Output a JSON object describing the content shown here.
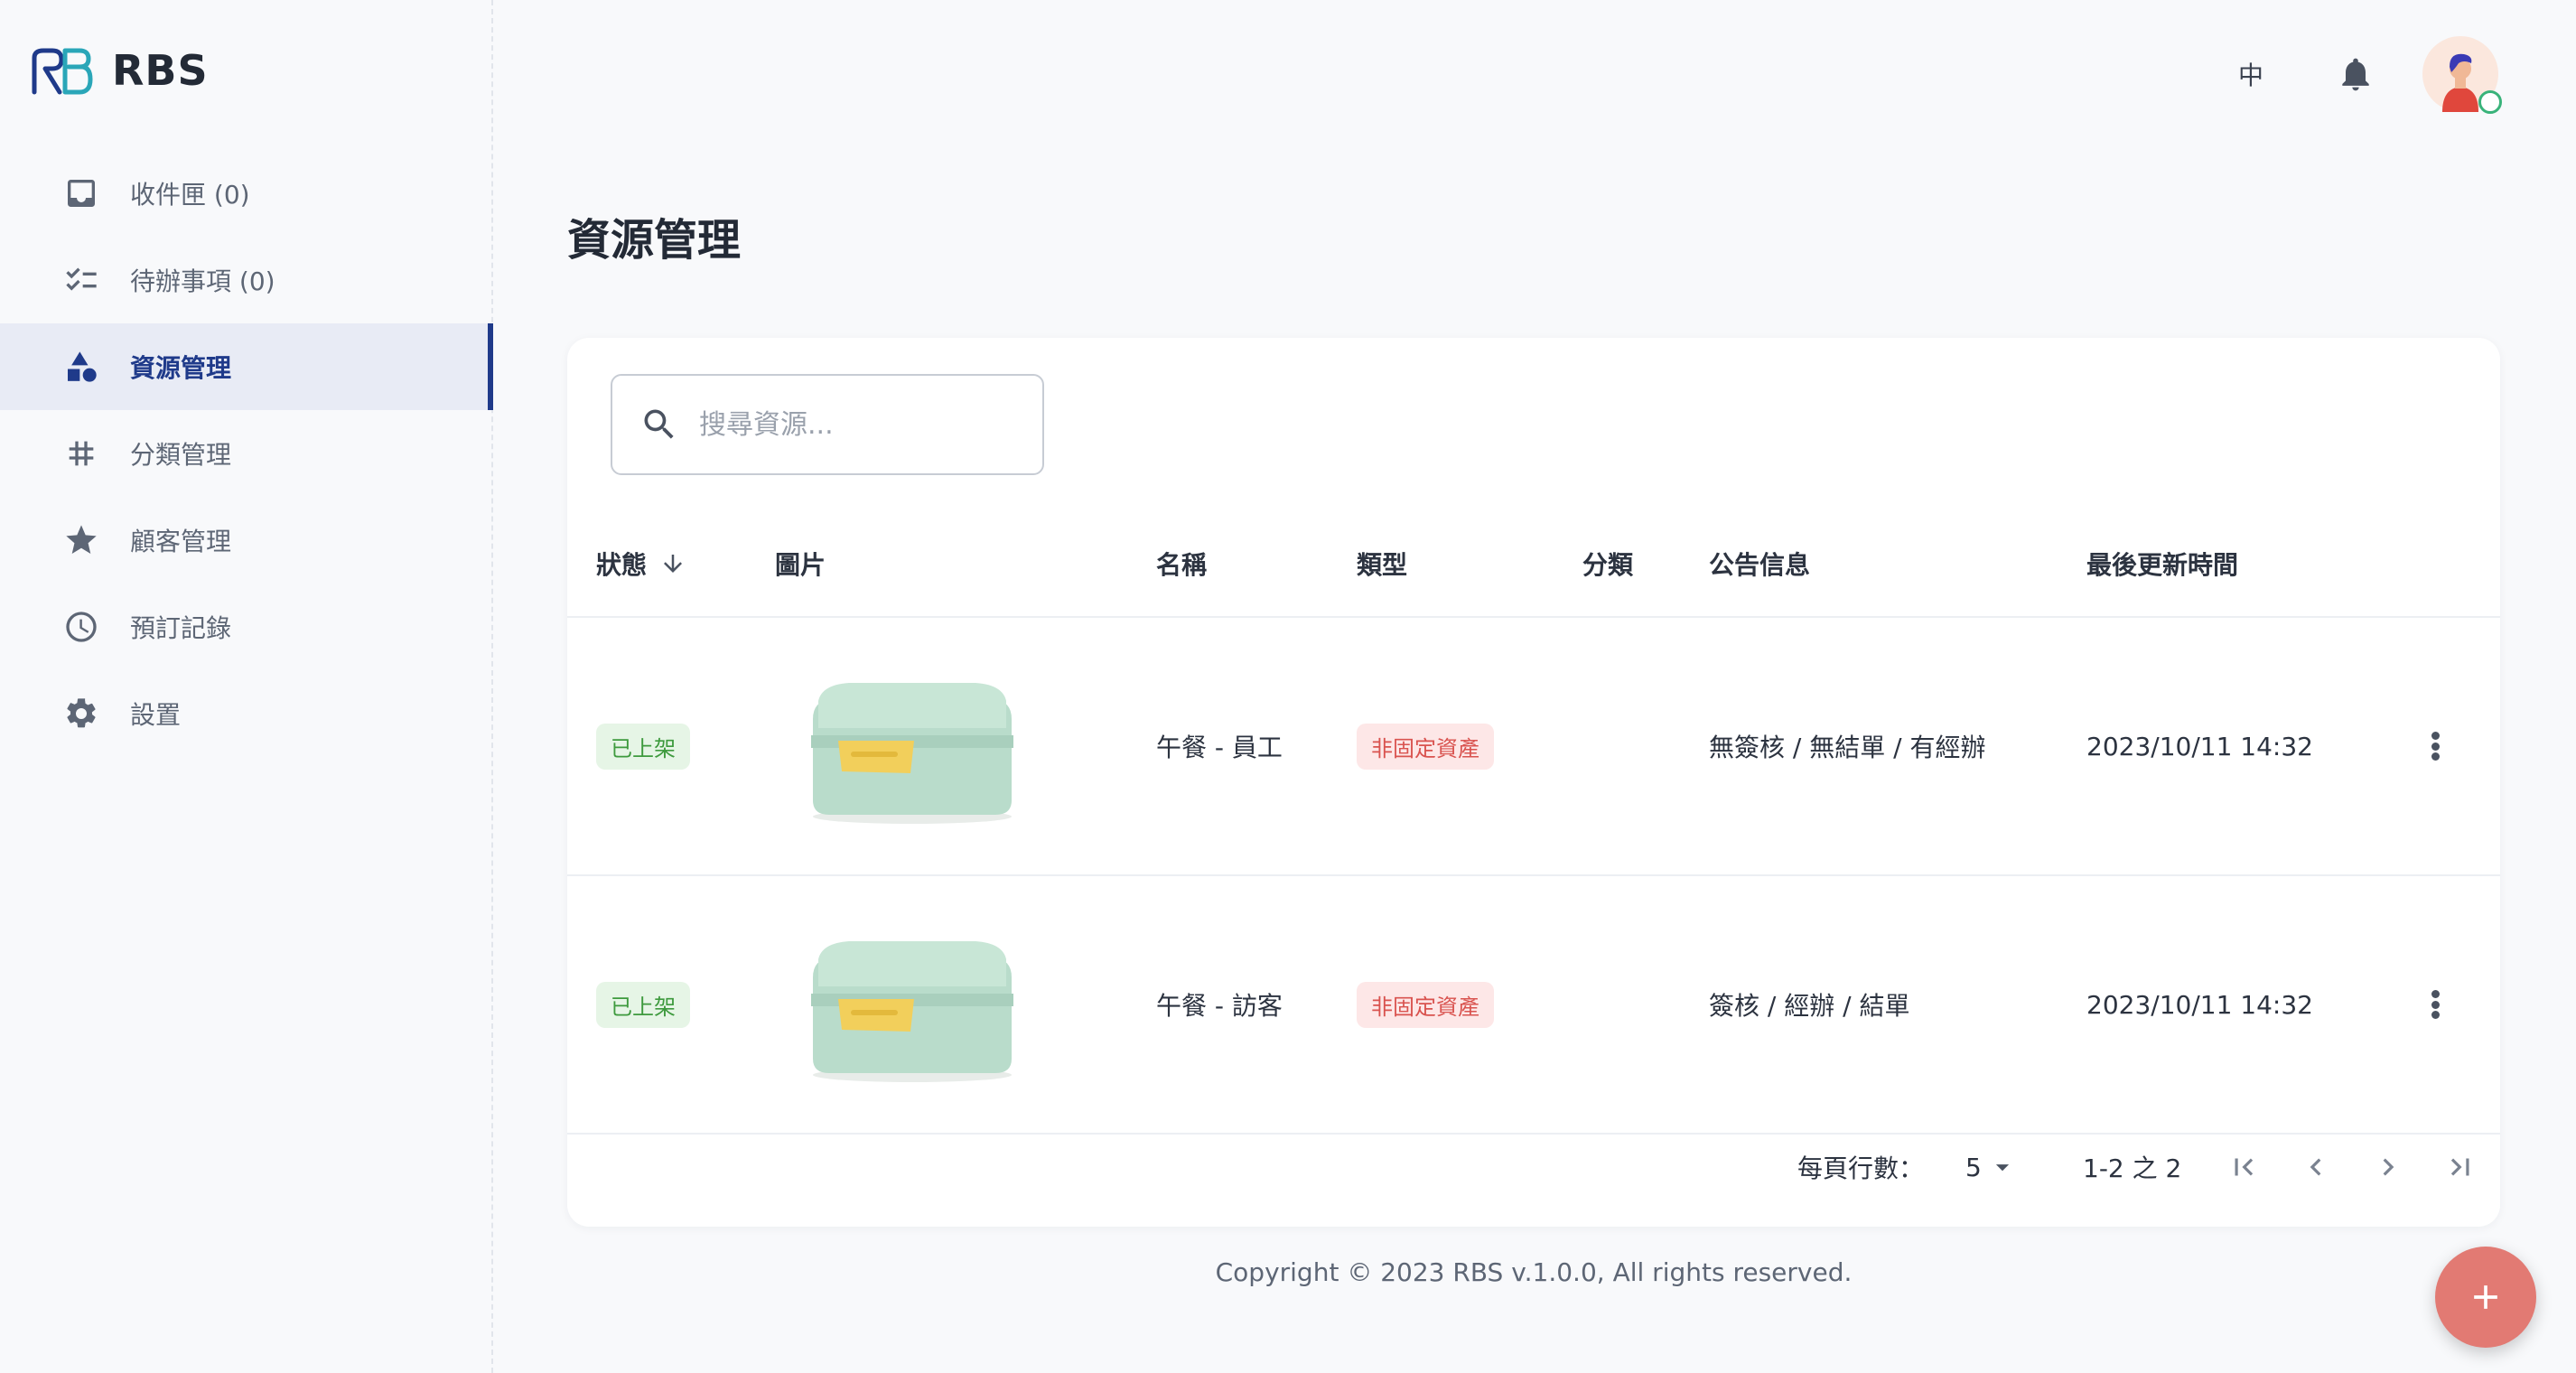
{
  "app": {
    "name": "RBS"
  },
  "sidebar": {
    "items": [
      {
        "label": "收件匣 (0)",
        "icon": "inbox-icon",
        "active": false
      },
      {
        "label": "待辦事項 (0)",
        "icon": "checklist-icon",
        "active": false
      },
      {
        "label": "資源管理",
        "icon": "shapes-icon",
        "active": true
      },
      {
        "label": "分類管理",
        "icon": "hashtag-icon",
        "active": false
      },
      {
        "label": "顧客管理",
        "icon": "star-icon",
        "active": false
      },
      {
        "label": "預訂記錄",
        "icon": "clock-icon",
        "active": false
      },
      {
        "label": "設置",
        "icon": "gear-icon",
        "active": false
      }
    ]
  },
  "topbar": {
    "language": "中"
  },
  "page": {
    "title": "資源管理"
  },
  "search": {
    "placeholder": "搜尋資源..."
  },
  "table": {
    "headers": {
      "status": "狀態",
      "image": "圖片",
      "name": "名稱",
      "type": "類型",
      "category": "分類",
      "notice": "公告信息",
      "updated": "最後更新時間"
    },
    "sort": {
      "column": "status",
      "direction": "descending"
    },
    "rows": [
      {
        "status": "已上架",
        "image": "lunchbox-image",
        "name": "午餐 - 員工",
        "type": "非固定資產",
        "category": "",
        "notice": "無簽核 / 無結單 / 有經辦",
        "updated": "2023/10/11 14:32"
      },
      {
        "status": "已上架",
        "image": "lunchbox-image",
        "name": "午餐 - 訪客",
        "type": "非固定資產",
        "category": "",
        "notice": "簽核 / 經辦 / 結單",
        "updated": "2023/10/11 14:32"
      }
    ]
  },
  "pagination": {
    "rows_per_page_label": "每頁行數：",
    "rows_per_page": "5",
    "range": "1-2 之 2"
  },
  "footer": {
    "text": "Copyright © 2023 RBS v.1.0.0, All rights reserved."
  },
  "colors": {
    "accent": "#1f3a8a",
    "fab": "#e27a73",
    "status_green": "#3e9a3e",
    "tag_red": "#d9534f"
  }
}
